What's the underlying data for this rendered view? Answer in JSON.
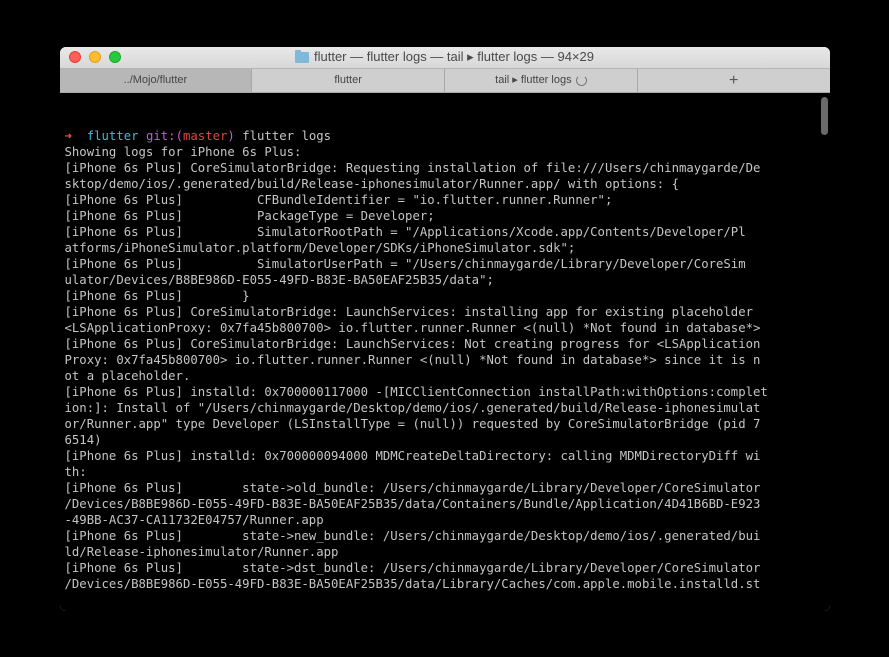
{
  "window": {
    "title": "flutter — flutter logs — tail ▸ flutter logs — 94×29"
  },
  "tabs": {
    "t0": "../Mojo/flutter",
    "t1": "flutter",
    "t2": "tail ▸ flutter logs",
    "plus": "+"
  },
  "prompt": {
    "arrow": "➜",
    "dir": "flutter",
    "git_label": "git:(",
    "branch": "master",
    "git_close": ")",
    "cmd": "flutter logs"
  },
  "log": {
    "l00": "Showing logs for iPhone 6s Plus:",
    "l01": "[iPhone 6s Plus] CoreSimulatorBridge: Requesting installation of file:///Users/chinmaygarde/De",
    "l02": "sktop/demo/ios/.generated/build/Release-iphonesimulator/Runner.app/ with options: {",
    "l03": "[iPhone 6s Plus]          CFBundleIdentifier = \"io.flutter.runner.Runner\";",
    "l04": "[iPhone 6s Plus]          PackageType = Developer;",
    "l05": "[iPhone 6s Plus]          SimulatorRootPath = \"/Applications/Xcode.app/Contents/Developer/Pl",
    "l06": "atforms/iPhoneSimulator.platform/Developer/SDKs/iPhoneSimulator.sdk\";",
    "l07": "[iPhone 6s Plus]          SimulatorUserPath = \"/Users/chinmaygarde/Library/Developer/CoreSim",
    "l08": "ulator/Devices/B8BE986D-E055-49FD-B83E-BA50EAF25B35/data\";",
    "l09": "[iPhone 6s Plus]        }",
    "l10": "[iPhone 6s Plus] CoreSimulatorBridge: LaunchServices: installing app for existing placeholder ",
    "l11": "<LSApplicationProxy: 0x7fa45b800700> io.flutter.runner.Runner <(null) *Not found in database*>",
    "l12": "[iPhone 6s Plus] CoreSimulatorBridge: LaunchServices: Not creating progress for <LSApplication",
    "l13": "Proxy: 0x7fa45b800700> io.flutter.runner.Runner <(null) *Not found in database*> since it is n",
    "l14": "ot a placeholder.",
    "l15": "[iPhone 6s Plus] installd: 0x700000117000 -[MICClientConnection installPath:withOptions:complet",
    "l16": "ion:]: Install of \"/Users/chinmaygarde/Desktop/demo/ios/.generated/build/Release-iphonesimulat",
    "l17": "or/Runner.app\" type Developer (LSInstallType = (null)) requested by CoreSimulatorBridge (pid 7",
    "l18": "6514)",
    "l19": "[iPhone 6s Plus] installd: 0x700000094000 MDMCreateDeltaDirectory: calling MDMDirectoryDiff wi",
    "l20": "th:",
    "l21": "[iPhone 6s Plus]        state->old_bundle: /Users/chinmaygarde/Library/Developer/CoreSimulator",
    "l22": "/Devices/B8BE986D-E055-49FD-B83E-BA50EAF25B35/data/Containers/Bundle/Application/4D41B6BD-E923",
    "l23": "-49BB-AC37-CA11732E04757/Runner.app",
    "l24": "[iPhone 6s Plus]        state->new_bundle: /Users/chinmaygarde/Desktop/demo/ios/.generated/bui",
    "l25": "ld/Release-iphonesimulator/Runner.app",
    "l26": "[iPhone 6s Plus]        state->dst_bundle: /Users/chinmaygarde/Library/Developer/CoreSimulator",
    "l27": "/Devices/B8BE986D-E055-49FD-B83E-BA50EAF25B35/data/Library/Caches/com.apple.mobile.installd.st"
  }
}
